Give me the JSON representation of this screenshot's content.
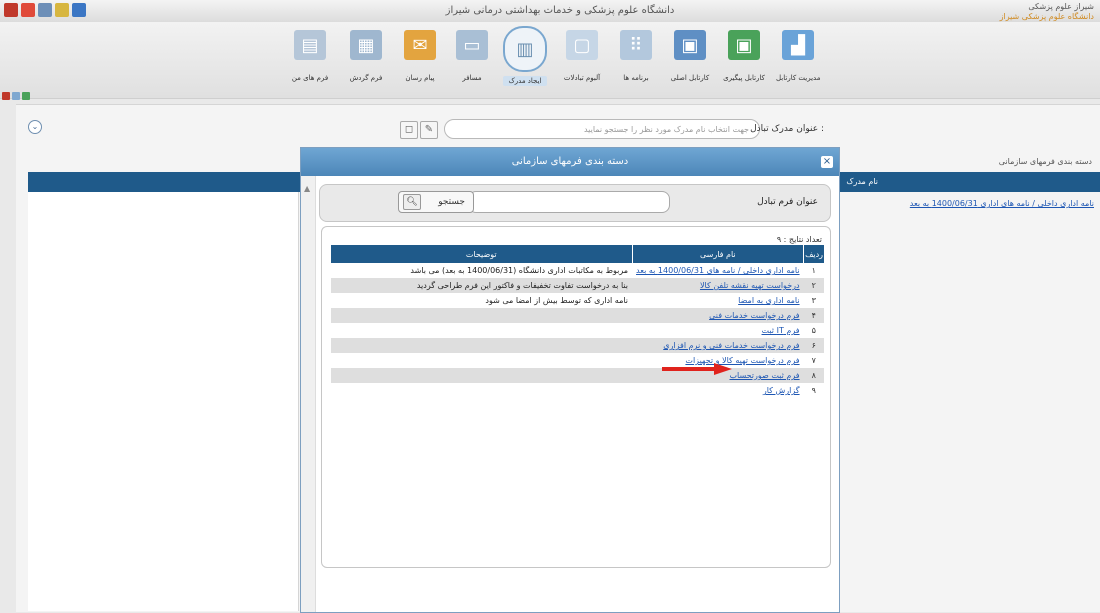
{
  "window": {
    "title": "دانشگاه علوم پزشکی و خدمات بهداشتی درمانی شیراز",
    "top_right_line1": "شیراز علوم پزشکی",
    "top_right_line2": "دانشگاه علوم پزشکی شیراز"
  },
  "ribbon": {
    "buttons": [
      {
        "label": "فرم های من",
        "icon": "form-icon"
      },
      {
        "label": "فرم گردش",
        "icon": "calendar-icon"
      },
      {
        "label": "پیام رسان",
        "icon": "mail-icon"
      },
      {
        "label": "مسافر",
        "icon": "card-icon"
      },
      {
        "label": "ایجاد مدرک",
        "icon": "document-icon"
      },
      {
        "label": "آلبوم تبادلات",
        "icon": "folder-icon"
      },
      {
        "label": "برنامه ها",
        "icon": "grid-icon"
      },
      {
        "label": "کارتابل اصلی",
        "icon": "inbox-icon"
      },
      {
        "label": "کارتابل پیگیری",
        "icon": "inbox-icon"
      },
      {
        "label": "مدیریت کارتابل",
        "icon": "chart-icon"
      }
    ]
  },
  "toolbar": {
    "search_label": "عنوان مدرک تبادل :",
    "search_placeholder": "جهت انتخاب نام مدرک مورد نظر را جستجو نمایید"
  },
  "right_panel": {
    "section_title": "دسته بندی فرمهای سازمانی",
    "header": "نام مدرک",
    "link": "نامه اداری داخلی / نامه های اداری 1400/06/31 به بعد"
  },
  "modal": {
    "title": "دسته بندی فرمهای سازمانی",
    "form_label": "عنوان فرم تبادل",
    "search_button": "جستجو",
    "results_count": "تعداد نتایج : ۹",
    "columns": {
      "num": "ردیف",
      "name": "نام فارسی",
      "desc": "توضیحات"
    },
    "rows": [
      {
        "num": "۱",
        "name": "نامه اداری داخلی / نامه های 1400/06/31 به بعد",
        "desc": "مربوط به مکاتبات اداری دانشگاه (1400/06/31 به بعد) می باشد",
        "alt": false
      },
      {
        "num": "۲",
        "name": "درخواست تهیه نقشه تلفن کالا",
        "desc": "بنا به درخواست تفاوت تخفیفات و فاکتور این فرم طراحی گردید",
        "alt": true
      },
      {
        "num": "۳",
        "name": "نامه اداری به امضا",
        "desc": "نامه اداری که توسط بیش از امضا می شود",
        "alt": false
      },
      {
        "num": "۴",
        "name": "فرم درخواست خدمات فنی",
        "desc": "",
        "alt": true
      },
      {
        "num": "۵",
        "name": "فرم IT ثبت",
        "desc": "",
        "alt": false
      },
      {
        "num": "۶",
        "name": "فرم درخواست خدمات فنی و نرم افزاری",
        "desc": "",
        "alt": true
      },
      {
        "num": "۷",
        "name": "فرم درخواست تهیه کالا و تجهیزات",
        "desc": "",
        "alt": false
      },
      {
        "num": "۸",
        "name": "فرم ثبت صورتحساب",
        "desc": "",
        "alt": true
      },
      {
        "num": "۹",
        "name": "گزارش کار",
        "desc": "",
        "alt": false
      }
    ]
  },
  "colors": {
    "header_blue": "#1f5a8a",
    "modal_title_blue": "#5b93c4",
    "link_blue": "#1d56b3",
    "annotation_red": "#e0231d"
  }
}
